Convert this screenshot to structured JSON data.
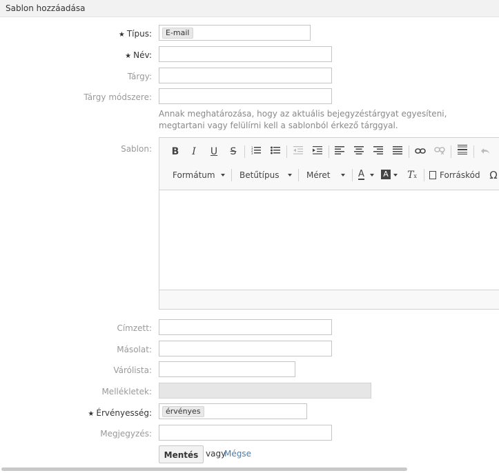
{
  "header": {
    "title": "Sablon hozzáadása"
  },
  "form": {
    "type": {
      "label": "Típus:",
      "value": "E-mail"
    },
    "name": {
      "label": "Név:"
    },
    "subject": {
      "label": "Tárgy:"
    },
    "subject_method": {
      "label": "Tárgy módszere:",
      "hint": "Annak meghatározása, hogy az aktuális bejegyzéstárgyat egyesíteni, megtartani vagy felülírni kell a sablonból érkező tárggyal."
    },
    "template": {
      "label": "Sablon:"
    },
    "to": {
      "label": "Címzett:"
    },
    "cc": {
      "label": "Másolat:"
    },
    "queue": {
      "label": "Várólista:"
    },
    "attachments": {
      "label": "Mellékletek:"
    },
    "validity": {
      "label": "Érvényesség:",
      "value": "érvényes"
    },
    "comment": {
      "label": "Megjegyzés:"
    }
  },
  "editor": {
    "format_label": "Formátum",
    "font_label": "Betűtípus",
    "size_label": "Méret",
    "source_label": "Forráskód",
    "buttons": {
      "bold": "B",
      "italic": "I",
      "underline": "U",
      "strike": "S",
      "text_color": "A",
      "bg_color": "A",
      "remove_format": "T",
      "omega": "Ω"
    },
    "icons": [
      "bold-icon",
      "italic-icon",
      "underline-icon",
      "strikethrough-icon",
      "numbered-list-icon",
      "bulleted-list-icon",
      "outdent-icon",
      "indent-icon",
      "align-left-icon",
      "align-center-icon",
      "align-right-icon",
      "justify-icon",
      "link-icon",
      "unlink-icon",
      "horizontal-rule-icon",
      "undo-icon",
      "text-color-icon",
      "background-color-icon",
      "remove-format-icon",
      "source-icon",
      "special-char-icon"
    ]
  },
  "actions": {
    "save": "Mentés",
    "or": "vagy",
    "cancel": "Mégse"
  }
}
